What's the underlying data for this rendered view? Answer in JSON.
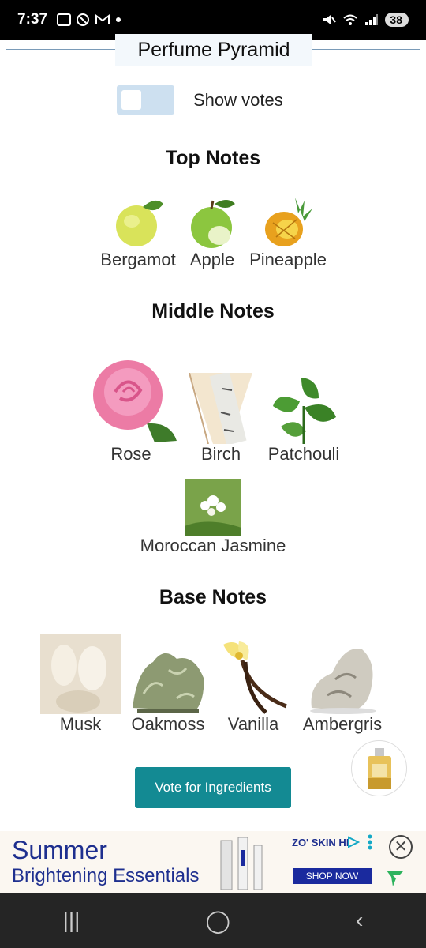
{
  "status_bar": {
    "time": "7:37",
    "battery": "38",
    "icons": [
      "screenshot-icon",
      "do-not-disturb-icon",
      "gmail-icon",
      "dot-icon",
      "mute-icon",
      "wifi-icon",
      "signal-icon"
    ]
  },
  "page": {
    "title": "Perfume Pyramid",
    "toggle_label": "Show votes"
  },
  "sections": {
    "top": {
      "title": "Top Notes",
      "notes": [
        "Bergamot",
        "Apple",
        "Pineapple"
      ]
    },
    "middle": {
      "title": "Middle Notes",
      "notes": [
        "Rose",
        "Birch",
        "Patchouli",
        "Moroccan Jasmine"
      ]
    },
    "base": {
      "title": "Base Notes",
      "notes": [
        "Musk",
        "Oakmoss",
        "Vanilla",
        "Ambergris"
      ]
    }
  },
  "vote_button": "Vote for Ingredients",
  "ad": {
    "headline_line1": "Summer",
    "headline_line2": "Brightening Essentials",
    "brand": "ZO' SKIN HI",
    "cta": "SHOP NOW"
  },
  "nav": {
    "recents": "|||",
    "home": "◯",
    "back": "‹"
  }
}
